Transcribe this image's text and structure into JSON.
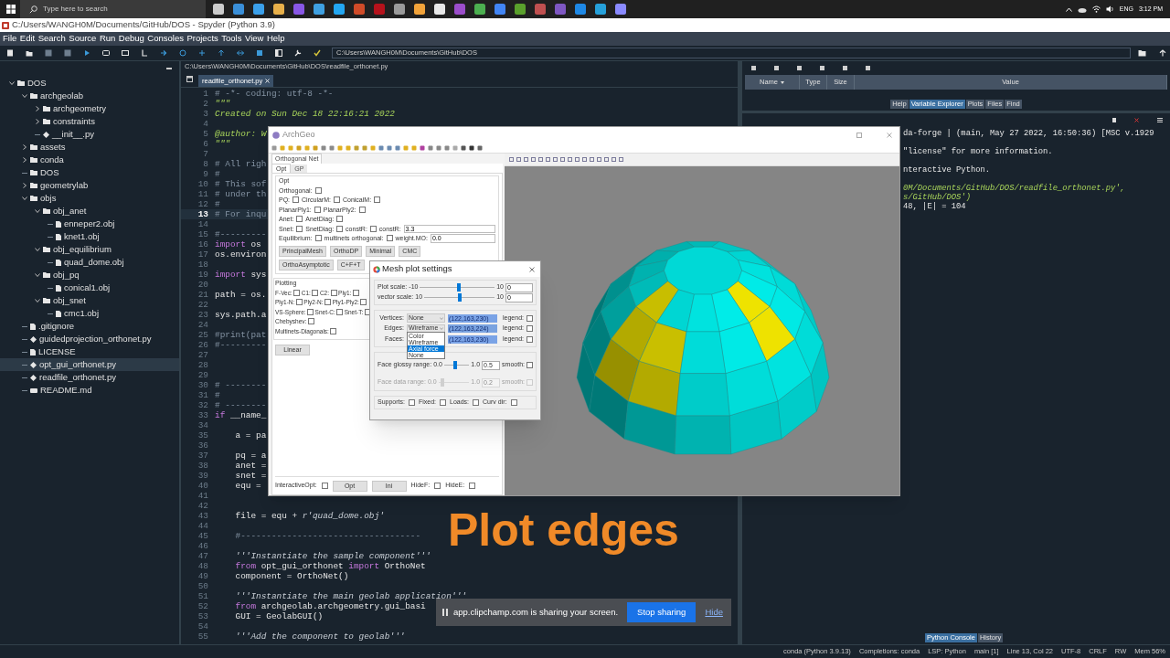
{
  "taskbar": {
    "search_placeholder": "Type here to search",
    "language": "ENG",
    "time": "3:12 PM"
  },
  "window": {
    "title": "C:/Users/WANGH0M/Documents/GitHub/DOS - Spyder (Python 3.9)"
  },
  "menu": [
    "File",
    "Edit",
    "Search",
    "Source",
    "Run",
    "Debug",
    "Consoles",
    "Projects",
    "Tools",
    "View",
    "Help"
  ],
  "toolbar": {
    "working_directory": "C:\\Users\\WANGH0M\\Documents\\GitHub\\DOS"
  },
  "file_tree": [
    {
      "name": "DOS",
      "kind": "folder",
      "expanded": true,
      "selected": false,
      "children": [
        {
          "name": "archgeolab",
          "kind": "folder",
          "expanded": true,
          "selected": false,
          "children": [
            {
              "name": "archgeometry",
              "kind": "folder",
              "expanded": false,
              "selected": false
            },
            {
              "name": "constraints",
              "kind": "folder",
              "expanded": false,
              "selected": false
            },
            {
              "name": "__init__.py",
              "kind": "python",
              "selected": false
            }
          ]
        },
        {
          "name": "assets",
          "kind": "folder",
          "expanded": false,
          "selected": false
        },
        {
          "name": "conda",
          "kind": "folder",
          "expanded": false,
          "selected": false
        },
        {
          "name": "DOS",
          "kind": "empty-folder",
          "selected": false
        },
        {
          "name": "geometrylab",
          "kind": "folder",
          "expanded": false,
          "selected": false
        },
        {
          "name": "objs",
          "kind": "folder",
          "expanded": true,
          "selected": false,
          "children": [
            {
              "name": "obj_anet",
              "kind": "folder",
              "expanded": true,
              "selected": false,
              "children": [
                {
                  "name": "enneper2.obj",
                  "kind": "file",
                  "selected": false
                },
                {
                  "name": "knet1.obj",
                  "kind": "file",
                  "selected": false
                }
              ]
            },
            {
              "name": "obj_equilibrium",
              "kind": "folder",
              "expanded": true,
              "selected": false,
              "children": [
                {
                  "name": "quad_dome.obj",
                  "kind": "file",
                  "selected": false
                }
              ]
            },
            {
              "name": "obj_pq",
              "kind": "folder",
              "expanded": true,
              "selected": false,
              "children": [
                {
                  "name": "conical1.obj",
                  "kind": "file",
                  "selected": false
                }
              ]
            },
            {
              "name": "obj_snet",
              "kind": "folder",
              "expanded": true,
              "selected": false,
              "children": [
                {
                  "name": "cmc1.obj",
                  "kind": "file",
                  "selected": false
                }
              ]
            }
          ]
        },
        {
          "name": ".gitignore",
          "kind": "file",
          "selected": false
        },
        {
          "name": "guidedprojection_orthonet.py",
          "kind": "python",
          "selected": false
        },
        {
          "name": "LICENSE",
          "kind": "file",
          "selected": false
        },
        {
          "name": "opt_gui_orthonet.py",
          "kind": "python",
          "selected": true
        },
        {
          "name": "readfile_orthonet.py",
          "kind": "python",
          "selected": false
        },
        {
          "name": "README.md",
          "kind": "markdown",
          "selected": false
        }
      ]
    }
  ],
  "editor": {
    "path": "C:\\Users\\WANGH0M\\Documents\\GitHub\\DOS\\readfile_orthonet.py",
    "tabs": [
      {
        "label": "readfile_orthonet.py",
        "selected": true
      }
    ],
    "lines": [
      {
        "number": "1",
        "current": false,
        "parts": [
          {
            "text": "# -*- coding: utf-8 -*-",
            "kind": "comment"
          }
        ]
      },
      {
        "number": "2",
        "current": false,
        "parts": [
          {
            "text": "\"\"\"",
            "kind": "docstring"
          }
        ]
      },
      {
        "number": "3",
        "current": false,
        "parts": [
          {
            "text": "Created on Sun Dec 18 22:16:21 2022",
            "kind": "docstring"
          }
        ]
      },
      {
        "number": "4",
        "current": false
      },
      {
        "number": "5",
        "current": false,
        "parts": [
          {
            "text": "@author: W",
            "kind": "docstring"
          }
        ]
      },
      {
        "number": "6",
        "current": false,
        "parts": [
          {
            "text": "\"\"\"",
            "kind": "docstring"
          }
        ]
      },
      {
        "number": "7",
        "current": false
      },
      {
        "number": "8",
        "current": false,
        "parts": [
          {
            "text": "# All righ",
            "kind": "comment"
          }
        ]
      },
      {
        "number": "9",
        "current": false,
        "parts": [
          {
            "text": "#",
            "kind": "comment"
          }
        ]
      },
      {
        "number": "10",
        "current": false,
        "parts": [
          {
            "text": "# This sof",
            "kind": "comment"
          }
        ]
      },
      {
        "number": "11",
        "current": false,
        "parts": [
          {
            "text": "# under th",
            "kind": "comment"
          }
        ]
      },
      {
        "number": "12",
        "current": false,
        "parts": [
          {
            "text": "#",
            "kind": "comment"
          }
        ]
      },
      {
        "number": "13",
        "current": true,
        "parts": [
          {
            "text": "# For inqu",
            "kind": "comment"
          }
        ]
      },
      {
        "number": "14",
        "current": false
      },
      {
        "number": "15",
        "current": false,
        "parts": [
          {
            "text": "#---------",
            "kind": "comment"
          }
        ]
      },
      {
        "number": "16",
        "current": false,
        "parts": [
          {
            "text": "import",
            "kind": "keyword"
          },
          {
            "text": " os",
            "kind": "code"
          }
        ]
      },
      {
        "number": "17",
        "current": false,
        "parts": [
          {
            "text": "os.environ",
            "kind": "code"
          }
        ]
      },
      {
        "number": "18",
        "current": false
      },
      {
        "number": "19",
        "current": false,
        "parts": [
          {
            "text": "import",
            "kind": "keyword"
          },
          {
            "text": " sys",
            "kind": "code"
          }
        ]
      },
      {
        "number": "20",
        "current": false
      },
      {
        "number": "21",
        "current": false,
        "parts": [
          {
            "text": "path = os.",
            "kind": "code"
          }
        ]
      },
      {
        "number": "22",
        "current": false
      },
      {
        "number": "23",
        "current": false,
        "parts": [
          {
            "text": "sys.path.a",
            "kind": "code"
          }
        ]
      },
      {
        "number": "24",
        "current": false
      },
      {
        "number": "25",
        "current": false,
        "parts": [
          {
            "text": "#print(pat",
            "kind": "comment"
          }
        ]
      },
      {
        "number": "26",
        "current": false,
        "parts": [
          {
            "text": "#---------",
            "kind": "comment"
          }
        ]
      },
      {
        "number": "27",
        "current": false
      },
      {
        "number": "28",
        "current": false
      },
      {
        "number": "29",
        "current": false
      },
      {
        "number": "30",
        "current": false,
        "parts": [
          {
            "text": "# --------",
            "kind": "comment"
          }
        ]
      },
      {
        "number": "31",
        "current": false,
        "parts": [
          {
            "text": "#",
            "kind": "comment"
          }
        ]
      },
      {
        "number": "32",
        "current": false,
        "parts": [
          {
            "text": "# --------",
            "kind": "comment"
          }
        ]
      },
      {
        "number": "33",
        "current": false,
        "parts": [
          {
            "text": "if",
            "kind": "keyword"
          },
          {
            "text": " __name_",
            "kind": "code"
          }
        ]
      },
      {
        "number": "34",
        "current": false
      },
      {
        "number": "35",
        "current": false,
        "parts": [
          {
            "text": "    a = pa",
            "kind": "code"
          }
        ]
      },
      {
        "number": "36",
        "current": false
      },
      {
        "number": "37",
        "current": false,
        "parts": [
          {
            "text": "    pq = a",
            "kind": "code"
          }
        ]
      },
      {
        "number": "38",
        "current": false,
        "parts": [
          {
            "text": "    anet =",
            "kind": "code"
          }
        ]
      },
      {
        "number": "39",
        "current": false,
        "parts": [
          {
            "text": "    snet =",
            "kind": "code"
          }
        ]
      },
      {
        "number": "40",
        "current": false,
        "parts": [
          {
            "text": "    equ = ",
            "kind": "code"
          }
        ]
      },
      {
        "number": "41",
        "current": false
      },
      {
        "number": "42",
        "current": false
      },
      {
        "number": "43",
        "current": false,
        "parts": [
          {
            "text": "    file = equ + ",
            "kind": "code"
          },
          {
            "text": "r'quad_dome.obj'",
            "kind": "string"
          }
        ]
      },
      {
        "number": "44",
        "current": false
      },
      {
        "number": "45",
        "current": false,
        "parts": [
          {
            "text": "    #-----------------------------------",
            "kind": "comment"
          }
        ]
      },
      {
        "number": "46",
        "current": false
      },
      {
        "number": "47",
        "current": false,
        "parts": [
          {
            "text": "    '''Instantiate the sample component'''",
            "kind": "string"
          }
        ]
      },
      {
        "number": "48",
        "current": false,
        "parts": [
          {
            "text": "    from",
            "kind": "keyword"
          },
          {
            "text": " opt_gui_orthonet ",
            "kind": "code"
          },
          {
            "text": "import",
            "kind": "keyword"
          },
          {
            "text": " OrthoNet",
            "kind": "code"
          }
        ]
      },
      {
        "number": "49",
        "current": false,
        "parts": [
          {
            "text": "    component = OrthoNet()",
            "kind": "code"
          }
        ]
      },
      {
        "number": "50",
        "current": false
      },
      {
        "number": "51",
        "current": false,
        "parts": [
          {
            "text": "    '''Instantiate the main geolab application'''",
            "kind": "string"
          }
        ]
      },
      {
        "number": "52",
        "current": false,
        "parts": [
          {
            "text": "    from",
            "kind": "keyword"
          },
          {
            "text": " archgeolab.archgeometry.gui_basi",
            "kind": "code"
          }
        ]
      },
      {
        "number": "53",
        "current": false,
        "parts": [
          {
            "text": "    GUI = GeolabGUI()",
            "kind": "code"
          }
        ]
      },
      {
        "number": "54",
        "current": false
      },
      {
        "number": "55",
        "current": false,
        "parts": [
          {
            "text": "    '''Add the component to geolab'''",
            "kind": "string"
          }
        ]
      }
    ]
  },
  "variable_explorer": {
    "columns": [
      "Name",
      "Type",
      "Size",
      "Value"
    ],
    "tabs": [
      {
        "label": "Help",
        "selected": false
      },
      {
        "label": "Variable Explorer",
        "selected": true
      },
      {
        "label": "Plots",
        "selected": false
      },
      {
        "label": "Files",
        "selected": false
      },
      {
        "label": "Find",
        "selected": false
      }
    ]
  },
  "console": {
    "lines": [
      {
        "text": "da-forge | (main, May 27 2022, 16:50:36) [MSC v.1929",
        "kind": "plain",
        "space_before": false
      },
      {
        "text": "\"license\" for more information.",
        "kind": "plain",
        "space_before": true
      },
      {
        "text": "nteractive Python.",
        "kind": "plain",
        "space_before": true
      },
      {
        "text": "0M/Documents/GitHub/DOS/readfile_orthonet.py',",
        "kind": "path",
        "space_before": true
      },
      {
        "text": "s/GitHub/DOS')",
        "kind": "path",
        "space_before": false
      },
      {
        "text": "48, |E| = 104",
        "kind": "plain",
        "space_before": false
      }
    ],
    "tabs": [
      {
        "label": "Python Console",
        "selected": true
      },
      {
        "label": "History",
        "selected": false
      }
    ]
  },
  "status_bar": [
    "conda (Python 3.9.13)",
    "Completions: conda",
    "LSP: Python",
    "main [1]",
    "Line 13, Col 22",
    "UTF-8",
    "CRLF",
    "RW",
    "Mem 56%"
  ],
  "archgeo": {
    "title": "ArchGeo",
    "panel_tab": "Orthogonal Net",
    "sub_tabs": [
      {
        "label": "Opt",
        "selected": true
      },
      {
        "label": "GP",
        "selected": false
      }
    ],
    "opt_group": {
      "title": "Opt",
      "rows": [
        {
          "items": [
            {
              "label": "Orthogonal:",
              "kind": "checkbox",
              "checked": false
            }
          ]
        },
        {
          "items": [
            {
              "label": "PQ:",
              "kind": "checkbox",
              "checked": false
            },
            {
              "label": "CircularM:",
              "kind": "checkbox",
              "checked": false
            },
            {
              "label": "ConicalM:",
              "kind": "checkbox",
              "checked": false
            }
          ]
        },
        {
          "items": [
            {
              "label": "PlanarPly1:",
              "kind": "checkbox",
              "checked": false
            },
            {
              "label": "PlanarPly2:",
              "kind": "checkbox",
              "checked": false
            }
          ]
        },
        {
          "items": [
            {
              "label": "Anet:",
              "kind": "checkbox",
              "checked": false
            },
            {
              "label": "AnetDiag:",
              "kind": "checkbox",
              "checked": false
            }
          ]
        },
        {
          "items": [
            {
              "label": "Snet:",
              "kind": "checkbox",
              "checked": false
            },
            {
              "label": "SnetDiag:",
              "kind": "checkbox",
              "checked": false
            },
            {
              "label": "constR:",
              "kind": "checkbox",
              "checked": false
            },
            {
              "label": "constR:",
              "kind": "field",
              "value": "3.3"
            }
          ]
        },
        {
          "items": [
            {
              "label": "Equilibrium:",
              "kind": "checkbox",
              "checked": false
            },
            {
              "label": "multinets orthogonal:",
              "kind": "checkbox",
              "checked": false
            },
            {
              "label": "weight.MO:",
              "kind": "field",
              "value": "0.0"
            }
          ]
        }
      ],
      "buttons": [
        [
          "PrincipalMesh",
          "OrthoDP",
          "Minimal",
          "CMC"
        ],
        [
          "OrthoAsymptotic",
          "C+F+T"
        ]
      ]
    },
    "plotting_group": {
      "title": "Plotting",
      "rows": [
        {
          "items": [
            {
              "label": "F-Vec:",
              "kind": "checkbox",
              "checked": false
            },
            {
              "label": "C1:",
              "kind": "checkbox",
              "checked": false
            },
            {
              "label": "C2:",
              "kind": "checkbox",
              "checked": false
            },
            {
              "label": "Ply1:",
              "kind": "checkbox",
              "checked": false
            }
          ]
        },
        {
          "items": [
            {
              "label": "Ply1-N:",
              "kind": "checkbox",
              "checked": false
            },
            {
              "label": "Ply2-N:",
              "kind": "checkbox",
              "checked": false
            },
            {
              "label": "Ply1-Ply2:",
              "kind": "checkbox",
              "checked": false
            }
          ]
        },
        {
          "items": [
            {
              "label": "VS-Sphere:",
              "kind": "checkbox",
              "checked": false
            },
            {
              "label": "Snet-C:",
              "kind": "checkbox",
              "checked": false
            },
            {
              "label": "Snet-T:",
              "kind": "checkbox",
              "checked": false
            }
          ]
        },
        {
          "items": [
            {
              "label": "Chebyshev:",
              "kind": "checkbox",
              "checked": false
            }
          ]
        },
        {
          "items": [
            {
              "label": "Multinets-Diagonals:",
              "kind": "checkbox",
              "checked": false
            }
          ]
        }
      ],
      "button": "Linear"
    },
    "bottom": [
      {
        "label": "InteractiveOpt:",
        "kind": "checkbox",
        "checked": false
      },
      {
        "label": "Opt",
        "kind": "button"
      },
      {
        "label": "Ini",
        "kind": "button"
      },
      {
        "label": "HideF:",
        "kind": "checkbox",
        "checked": false
      },
      {
        "label": "HideE:",
        "kind": "checkbox",
        "checked": false
      }
    ]
  },
  "mesh_plot_settings": {
    "title": "Mesh plot settings",
    "sliders": [
      {
        "label": "Plot scale:",
        "min": "-10",
        "max": "10",
        "value": "0",
        "level": 0.52
      },
      {
        "label": "vector scale:",
        "min": "10",
        "max": "10",
        "value": "0",
        "level": 0.5
      }
    ],
    "layers": [
      {
        "label": "Vertices:",
        "choice": "None",
        "color": "#7aa3e6",
        "color_text": "(122,163,230)",
        "legend_label": "legend:",
        "legend": false
      },
      {
        "label": "Edges:",
        "choice": "Wireframe",
        "color": "#7aa3e0",
        "color_text": "(122,163,224)",
        "legend_label": "legend:",
        "legend": false,
        "options": [
          {
            "label": "Color",
            "selected": false
          },
          {
            "label": "Wireframe",
            "selected": false
          },
          {
            "label": "Axial force",
            "selected": true
          },
          {
            "label": "None",
            "selected": false
          }
        ]
      },
      {
        "label": "Faces:",
        "color": "#7aa3e6",
        "color_text": "(122,163,230)",
        "legend_label": "legend:",
        "legend": false
      }
    ],
    "face_sliders": [
      {
        "label": "Face glossy range:",
        "min": "0.0",
        "max": "1.0",
        "value": "0.5",
        "level": 0.45,
        "disabled": false,
        "smooth_label": "smooth:",
        "smooth": false
      },
      {
        "label": "Face data range:",
        "min": "0.0",
        "max": "1.0",
        "value": "0.2",
        "level": 0.12,
        "disabled": true,
        "smooth_label": "smooth:",
        "smooth": false
      }
    ],
    "bottom": [
      {
        "label": "Supports:",
        "checked": false
      },
      {
        "label": "Fixed:",
        "checked": false
      },
      {
        "label": "Loads:",
        "checked": false
      },
      {
        "label": "Curv dir:",
        "checked": false
      }
    ]
  },
  "caption": "Plot edges",
  "share_bar": {
    "message": "app.clipchamp.com is sharing your screen.",
    "stop": "Stop sharing",
    "hide": "Hide"
  }
}
